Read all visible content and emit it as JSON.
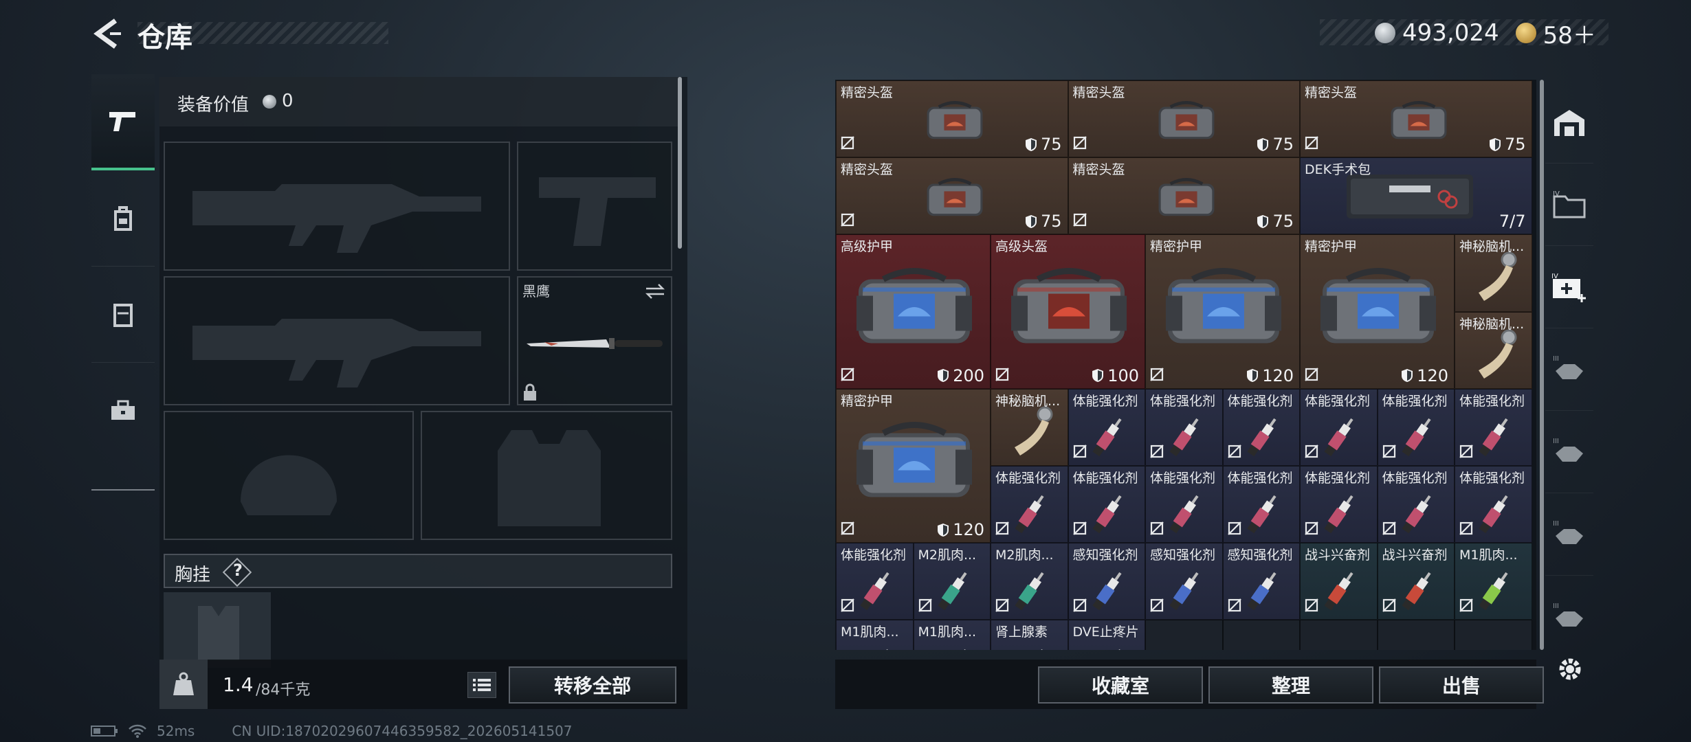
{
  "header": {
    "title": "仓库",
    "silver": "493,024",
    "gold": "58＋"
  },
  "equipment": {
    "value_label": "装备价值",
    "value": "0",
    "melee_name": "黑鹰",
    "chest_label": "胸挂",
    "help": "?"
  },
  "capacity": {
    "current": "1.4",
    "max": "/84千克"
  },
  "buttons": {
    "transfer_all": "转移全部",
    "collection": "收藏室",
    "organize": "整理",
    "sell": "出售"
  },
  "status": {
    "ping": "52ms",
    "uid": "CN UID:18702029607446359582_202605141507"
  },
  "right_tabs": [
    "IV",
    "IV",
    "III",
    "III",
    "III",
    "III"
  ],
  "grid": {
    "cells": [
      {
        "name": "精密头盔",
        "value": "75",
        "cls": "brown",
        "item": "bag",
        "col": 0,
        "row": 0,
        "w": 3,
        "h": 1,
        "nofs": true
      },
      {
        "name": "精密头盔",
        "value": "75",
        "cls": "brown",
        "item": "bag",
        "col": 3,
        "row": 0,
        "w": 3,
        "h": 1,
        "nofs": true
      },
      {
        "name": "精密头盔",
        "value": "75",
        "cls": "brown",
        "item": "bag",
        "col": 6,
        "row": 0,
        "w": 3,
        "h": 1,
        "nofs": true
      },
      {
        "name": "精密头盔",
        "value": "75",
        "cls": "brown",
        "item": "bag",
        "col": 0,
        "row": 1,
        "w": 3,
        "h": 1,
        "nofs": true
      },
      {
        "name": "精密头盔",
        "value": "75",
        "cls": "brown",
        "item": "bag",
        "col": 3,
        "row": 1,
        "w": 3,
        "h": 1,
        "nofs": true
      },
      {
        "name": "DEK手术包",
        "value": "7/7",
        "cls": "navy",
        "item": "kit",
        "col": 6,
        "row": 1,
        "w": 3,
        "h": 1,
        "noshield": true
      },
      {
        "name": "高级护甲",
        "value": "200",
        "cls": "red",
        "item": "bigbag",
        "col": 0,
        "row": 2,
        "w": 2,
        "h": 2,
        "nofs": true
      },
      {
        "name": "高级头盔",
        "value": "100",
        "cls": "red",
        "item": "bigbagred",
        "col": 2,
        "row": 2,
        "w": 2,
        "h": 2,
        "nofs": true
      },
      {
        "name": "精密护甲",
        "value": "120",
        "cls": "brown",
        "item": "bigbag",
        "col": 4,
        "row": 2,
        "w": 2,
        "h": 2,
        "nofs": true
      },
      {
        "name": "精密护甲",
        "value": "120",
        "cls": "brown",
        "item": "bigbag",
        "col": 6,
        "row": 2,
        "w": 2,
        "h": 2,
        "nofs": true
      },
      {
        "name": "神秘脑机...",
        "cls": "brown",
        "item": "scroll",
        "col": 8,
        "row": 2,
        "w": 1,
        "h": 1
      },
      {
        "name": "神秘脑机...",
        "cls": "brown",
        "item": "scroll",
        "col": 8,
        "row": 3,
        "w": 1,
        "h": 1
      },
      {
        "name": "精密护甲",
        "value": "120",
        "cls": "brown",
        "item": "bigbag",
        "col": 0,
        "row": 4,
        "w": 2,
        "h": 2,
        "nofs": true
      },
      {
        "name": "神秘脑机...",
        "cls": "brown",
        "item": "scroll",
        "col": 2,
        "row": 4,
        "w": 1,
        "h": 1
      },
      {
        "name": "体能强化剂",
        "cls": "navy",
        "item": "syr",
        "color": "#c0506e",
        "col": 3,
        "row": 4,
        "w": 1,
        "h": 1
      },
      {
        "name": "体能强化剂",
        "cls": "navy",
        "item": "syr",
        "color": "#c0506e",
        "col": 4,
        "row": 4,
        "w": 1,
        "h": 1
      },
      {
        "name": "体能强化剂",
        "cls": "navy",
        "item": "syr",
        "color": "#c0506e",
        "col": 5,
        "row": 4,
        "w": 1,
        "h": 1
      },
      {
        "name": "体能强化剂",
        "cls": "navy",
        "item": "syr",
        "color": "#c0506e",
        "col": 6,
        "row": 4,
        "w": 1,
        "h": 1
      },
      {
        "name": "体能强化剂",
        "cls": "navy",
        "item": "syr",
        "color": "#c0506e",
        "col": 7,
        "row": 4,
        "w": 1,
        "h": 1
      },
      {
        "name": "体能强化剂",
        "cls": "navy",
        "item": "syr",
        "color": "#c0506e",
        "col": 8,
        "row": 4,
        "w": 1,
        "h": 1
      },
      {
        "name": "体能强化剂",
        "cls": "navy",
        "item": "syr",
        "color": "#c0506e",
        "col": 2,
        "row": 5,
        "w": 1,
        "h": 1
      },
      {
        "name": "体能强化剂",
        "cls": "navy",
        "item": "syr",
        "color": "#c0506e",
        "col": 3,
        "row": 5,
        "w": 1,
        "h": 1
      },
      {
        "name": "体能强化剂",
        "cls": "navy",
        "item": "syr",
        "color": "#c0506e",
        "col": 4,
        "row": 5,
        "w": 1,
        "h": 1
      },
      {
        "name": "体能强化剂",
        "cls": "navy",
        "item": "syr",
        "color": "#c0506e",
        "col": 5,
        "row": 5,
        "w": 1,
        "h": 1
      },
      {
        "name": "体能强化剂",
        "cls": "navy",
        "item": "syr",
        "color": "#c0506e",
        "col": 6,
        "row": 5,
        "w": 1,
        "h": 1
      },
      {
        "name": "体能强化剂",
        "cls": "navy",
        "item": "syr",
        "color": "#c0506e",
        "col": 7,
        "row": 5,
        "w": 1,
        "h": 1
      },
      {
        "name": "体能强化剂",
        "cls": "navy",
        "item": "syr",
        "color": "#c0506e",
        "col": 8,
        "row": 5,
        "w": 1,
        "h": 1
      },
      {
        "name": "体能强化剂",
        "cls": "navy",
        "item": "syr",
        "color": "#c0506e",
        "col": 0,
        "row": 6,
        "w": 1,
        "h": 1
      },
      {
        "name": "M2肌肉...",
        "cls": "navy",
        "item": "syr",
        "color": "#3aa48a",
        "col": 1,
        "row": 6,
        "w": 1,
        "h": 1
      },
      {
        "name": "M2肌肉...",
        "cls": "navy",
        "item": "syr",
        "color": "#3aa48a",
        "col": 2,
        "row": 6,
        "w": 1,
        "h": 1
      },
      {
        "name": "感知强化剂",
        "cls": "navy",
        "item": "syr",
        "color": "#4a6ec8",
        "col": 3,
        "row": 6,
        "w": 1,
        "h": 1
      },
      {
        "name": "感知强化剂",
        "cls": "navy",
        "item": "syr",
        "color": "#4a6ec8",
        "col": 4,
        "row": 6,
        "w": 1,
        "h": 1
      },
      {
        "name": "感知强化剂",
        "cls": "navy",
        "item": "syr",
        "color": "#4a6ec8",
        "col": 5,
        "row": 6,
        "w": 1,
        "h": 1
      },
      {
        "name": "战斗兴奋剂",
        "cls": "teal",
        "item": "syr",
        "color": "#c84a3a",
        "col": 6,
        "row": 6,
        "w": 1,
        "h": 1
      },
      {
        "name": "战斗兴奋剂",
        "cls": "teal",
        "item": "syr",
        "color": "#c84a3a",
        "col": 7,
        "row": 6,
        "w": 1,
        "h": 1
      },
      {
        "name": "M1肌肉...",
        "cls": "teal",
        "item": "syr",
        "color": "#8ac84a",
        "col": 8,
        "row": 6,
        "w": 1,
        "h": 1
      },
      {
        "name": "M1肌肉...",
        "cls": "navy",
        "item": "syr",
        "color": "#6a8a4a",
        "col": 0,
        "row": 7,
        "w": 1,
        "h": 1
      },
      {
        "name": "M1肌肉...",
        "cls": "navy",
        "item": "syr",
        "color": "#6a8a4a",
        "col": 1,
        "row": 7,
        "w": 1,
        "h": 1
      },
      {
        "name": "肾上腺素",
        "cls": "navy",
        "item": "syr",
        "color": "#3a8a7a",
        "col": 2,
        "row": 7,
        "w": 1,
        "h": 1
      },
      {
        "name": "DVE止疼片",
        "cls": "navy",
        "item": "syr",
        "color": "#8a8a6a",
        "col": 3,
        "row": 7,
        "w": 1,
        "h": 1
      }
    ]
  }
}
